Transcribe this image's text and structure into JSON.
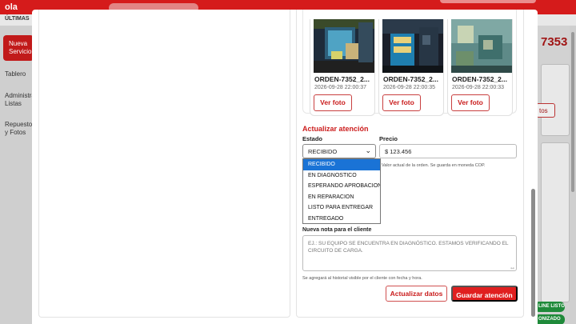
{
  "background": {
    "logo": "ola",
    "subbar_title": "ÚLTIMAS",
    "sidebar_active": "Nueva Servicio",
    "sidebar_items": [
      "Tablero",
      "Administrar Listas",
      "Repuestos y Fotos"
    ],
    "order_number": "7353",
    "datos_button": "tos",
    "green_badges": [
      "LINE LISTO",
      "ONIZADO"
    ]
  },
  "photos": [
    {
      "name": "ORDEN-7352_2...",
      "date": "2026-09-28 22:00:37",
      "button": "Ver foto"
    },
    {
      "name": "ORDEN-7352_2...",
      "date": "2026-09-28 22:00:35",
      "button": "Ver foto"
    },
    {
      "name": "ORDEN-7352_2...",
      "date": "2026-09-28 22:00:33",
      "button": "Ver foto"
    }
  ],
  "form": {
    "section_title": "Actualizar atención",
    "estado_label": "Estado",
    "estado_value": "RECIBIDO",
    "precio_label": "Precio",
    "precio_value": "$ 123.456",
    "precio_hint": "Valor actual de la orden. Se guarda en moneda COP.",
    "estado_options": [
      "RECIBIDO",
      "EN DIAGNOSTICO",
      "ESPERANDO APROBACION",
      "EN REPARACION",
      "LISTO PARA ENTREGAR",
      "ENTREGADO"
    ],
    "selected_option_index": 0,
    "nota_label": "Nueva nota para el cliente",
    "nota_placeholder": "EJ.: SU EQUIPO SE ENCUENTRA EN DIAGNÓSTICO. ESTAMOS VERIFICANDO EL CIRCUITO DE CARGA.",
    "nota_hint": "Se agregará al historial visible por el cliente con fecha y hora.",
    "btn_actualizar": "Actualizar datos",
    "btn_guardar": "Guardar atención"
  },
  "colors": {
    "brand_red": "#e01f1f",
    "section_red": "#cc1d1d",
    "select_highlight": "#1a73d6"
  }
}
